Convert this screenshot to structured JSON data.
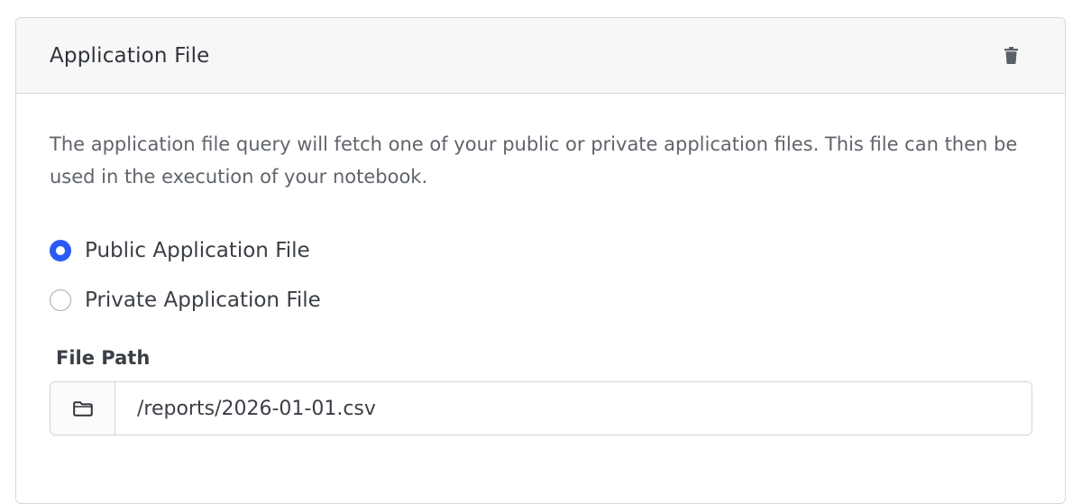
{
  "panel": {
    "title": "Application File",
    "delete_icon": "trash-icon",
    "description": "The application file query will fetch one of your public or private application files. This file can then be used in the execution of your notebook."
  },
  "file_type": {
    "options": [
      {
        "label": "Public Application File",
        "selected": true
      },
      {
        "label": "Private Application File",
        "selected": false
      }
    ]
  },
  "file_path": {
    "label": "File Path",
    "browse_icon": "folder-icon",
    "value": "/reports/2026-01-01.csv"
  },
  "colors": {
    "accent": "#2a5bf6",
    "header_bg": "#f7f7f8",
    "border": "#d6d8db"
  }
}
